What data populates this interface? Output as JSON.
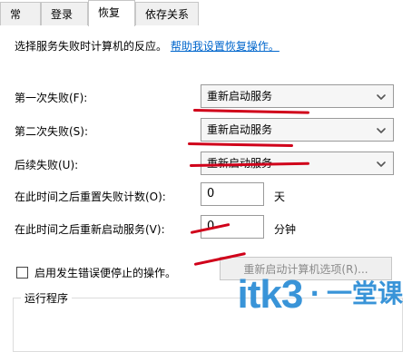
{
  "tabs": [
    {
      "label": "常规",
      "active": false
    },
    {
      "label": "登录",
      "active": false
    },
    {
      "label": "恢复",
      "active": true
    },
    {
      "label": "依存关系",
      "active": false
    }
  ],
  "intro": {
    "text": "选择服务失败时计算机的反应。",
    "link_text": "帮助我设置恢复操作。"
  },
  "recovery": {
    "first_failure_label": "第一次失败(F):",
    "first_failure_value": "重新启动服务",
    "second_failure_label": "第二次失败(S):",
    "second_failure_value": "重新启动服务",
    "subsequent_failure_label": "后续失败(U):",
    "subsequent_failure_value": "重新启动服务",
    "reset_count_label": "在此时间之后重置失败计数(O):",
    "reset_count_value": "0",
    "reset_count_unit": "天",
    "restart_after_label": "在此时间之后重新启动服务(V):",
    "restart_after_value": "0",
    "restart_after_unit": "分钟"
  },
  "options": {
    "stop_on_error_label": "启用发生错误便停止的操作。",
    "restart_computer_button": "重新启动计算机选项(R)..."
  },
  "groupbox": {
    "run_program_title": "运行程序"
  },
  "watermark": {
    "brand": "itk3",
    "dot": "·",
    "suffix": "一堂课"
  },
  "colors": {
    "annotation_red": "#d0001a",
    "link_blue": "#0066cc",
    "watermark_blue": "#2f8fd6"
  },
  "icons": {
    "dropdown": "chevron-down-icon"
  }
}
